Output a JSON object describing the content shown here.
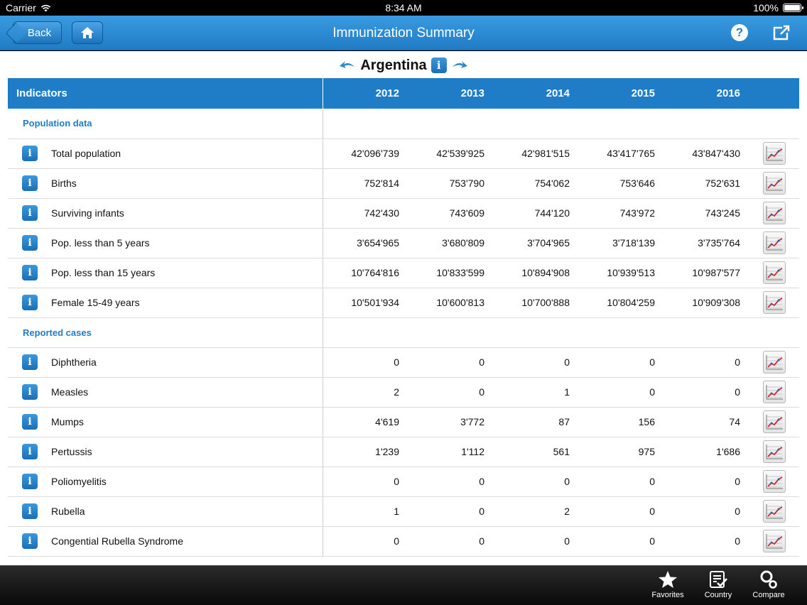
{
  "status": {
    "carrier": "Carrier",
    "time": "8:34 AM",
    "battery": "100%",
    "battery_level": 1.0
  },
  "nav": {
    "back_label": "Back",
    "title": "Immunization Summary",
    "help_label": "?"
  },
  "country": {
    "name": "Argentina",
    "info_label": "i"
  },
  "table": {
    "indicator_header": "Indicators",
    "years": [
      "2012",
      "2013",
      "2014",
      "2015",
      "2016"
    ],
    "sections": [
      {
        "title": "Population data",
        "rows": [
          {
            "label": "Total population",
            "values": [
              "42'096'739",
              "42'539'925",
              "42'981'515",
              "43'417'765",
              "43'847'430"
            ]
          },
          {
            "label": "Births",
            "values": [
              "752'814",
              "753'790",
              "754'062",
              "753'646",
              "752'631"
            ]
          },
          {
            "label": "Surviving infants",
            "values": [
              "742'430",
              "743'609",
              "744'120",
              "743'972",
              "743'245"
            ]
          },
          {
            "label": "Pop. less than 5 years",
            "values": [
              "3'654'965",
              "3'680'809",
              "3'704'965",
              "3'718'139",
              "3'735'764"
            ]
          },
          {
            "label": "Pop. less than 15 years",
            "values": [
              "10'764'816",
              "10'833'599",
              "10'894'908",
              "10'939'513",
              "10'987'577"
            ]
          },
          {
            "label": "Female 15-49 years",
            "values": [
              "10'501'934",
              "10'600'813",
              "10'700'888",
              "10'804'259",
              "10'909'308"
            ]
          }
        ]
      },
      {
        "title": "Reported cases",
        "rows": [
          {
            "label": "Diphtheria",
            "values": [
              "0",
              "0",
              "0",
              "0",
              "0"
            ]
          },
          {
            "label": "Measles",
            "values": [
              "2",
              "0",
              "1",
              "0",
              "0"
            ]
          },
          {
            "label": "Mumps",
            "values": [
              "4'619",
              "3'772",
              "87",
              "156",
              "74"
            ]
          },
          {
            "label": "Pertussis",
            "values": [
              "1'239",
              "1'112",
              "561",
              "975",
              "1'686"
            ]
          },
          {
            "label": "Poliomyelitis",
            "values": [
              "0",
              "0",
              "0",
              "0",
              "0"
            ]
          },
          {
            "label": "Rubella",
            "values": [
              "1",
              "0",
              "2",
              "0",
              "0"
            ]
          },
          {
            "label": "Congential Rubella Syndrome",
            "values": [
              "0",
              "0",
              "0",
              "0",
              "0"
            ]
          }
        ]
      }
    ],
    "row_info_label": "i",
    "row_icons": {
      "info": "info-icon",
      "trend": "trend-chart-icon"
    }
  },
  "tabbar": {
    "items": [
      {
        "label": "Favorites",
        "icon": "star-icon"
      },
      {
        "label": "Country",
        "icon": "clipboard-check-icon"
      },
      {
        "label": "Compare",
        "icon": "compare-circles-icon"
      }
    ]
  },
  "colors": {
    "nav_blue": "#1f7cc6",
    "section_blue": "#1f7cc6",
    "tabbar": "#111111"
  }
}
